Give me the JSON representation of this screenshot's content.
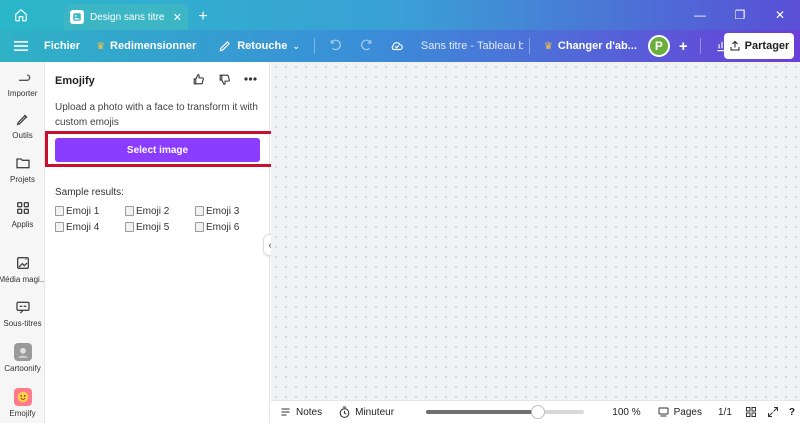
{
  "tab": {
    "title": "Design sans titre - ...",
    "close": "✕"
  },
  "toolbar": {
    "file": "Fichier",
    "resize": "Redimensionner",
    "retouch": "Retouche",
    "doc_title": "Sans titre - Tableau bl...",
    "upgrade": "Changer d'ab...",
    "avatar": "P",
    "share": "Partager"
  },
  "rail": [
    {
      "label": "Importer"
    },
    {
      "label": "Outils"
    },
    {
      "label": "Projets"
    },
    {
      "label": "Applis"
    },
    {
      "label": "Média magi..."
    },
    {
      "label": "Sous-titres"
    },
    {
      "label": "Cartoonify"
    },
    {
      "label": "Emojify"
    }
  ],
  "panel": {
    "title": "Emojify",
    "description": "Upload a photo with a face to transform it with custom emojis",
    "select_button": "Select image",
    "sample_title": "Sample results:",
    "samples": [
      "Emoji 1",
      "Emoji 2",
      "Emoji 3",
      "Emoji 4",
      "Emoji 5",
      "Emoji 6"
    ]
  },
  "bottombar": {
    "notes": "Notes",
    "timer": "Minuteur",
    "zoom": "100 %",
    "zoom_fraction": 0.62,
    "pages": "Pages",
    "page_count": "1/1"
  },
  "colors": {
    "accent": "#8b3dff",
    "highlight": "#c8102e"
  }
}
